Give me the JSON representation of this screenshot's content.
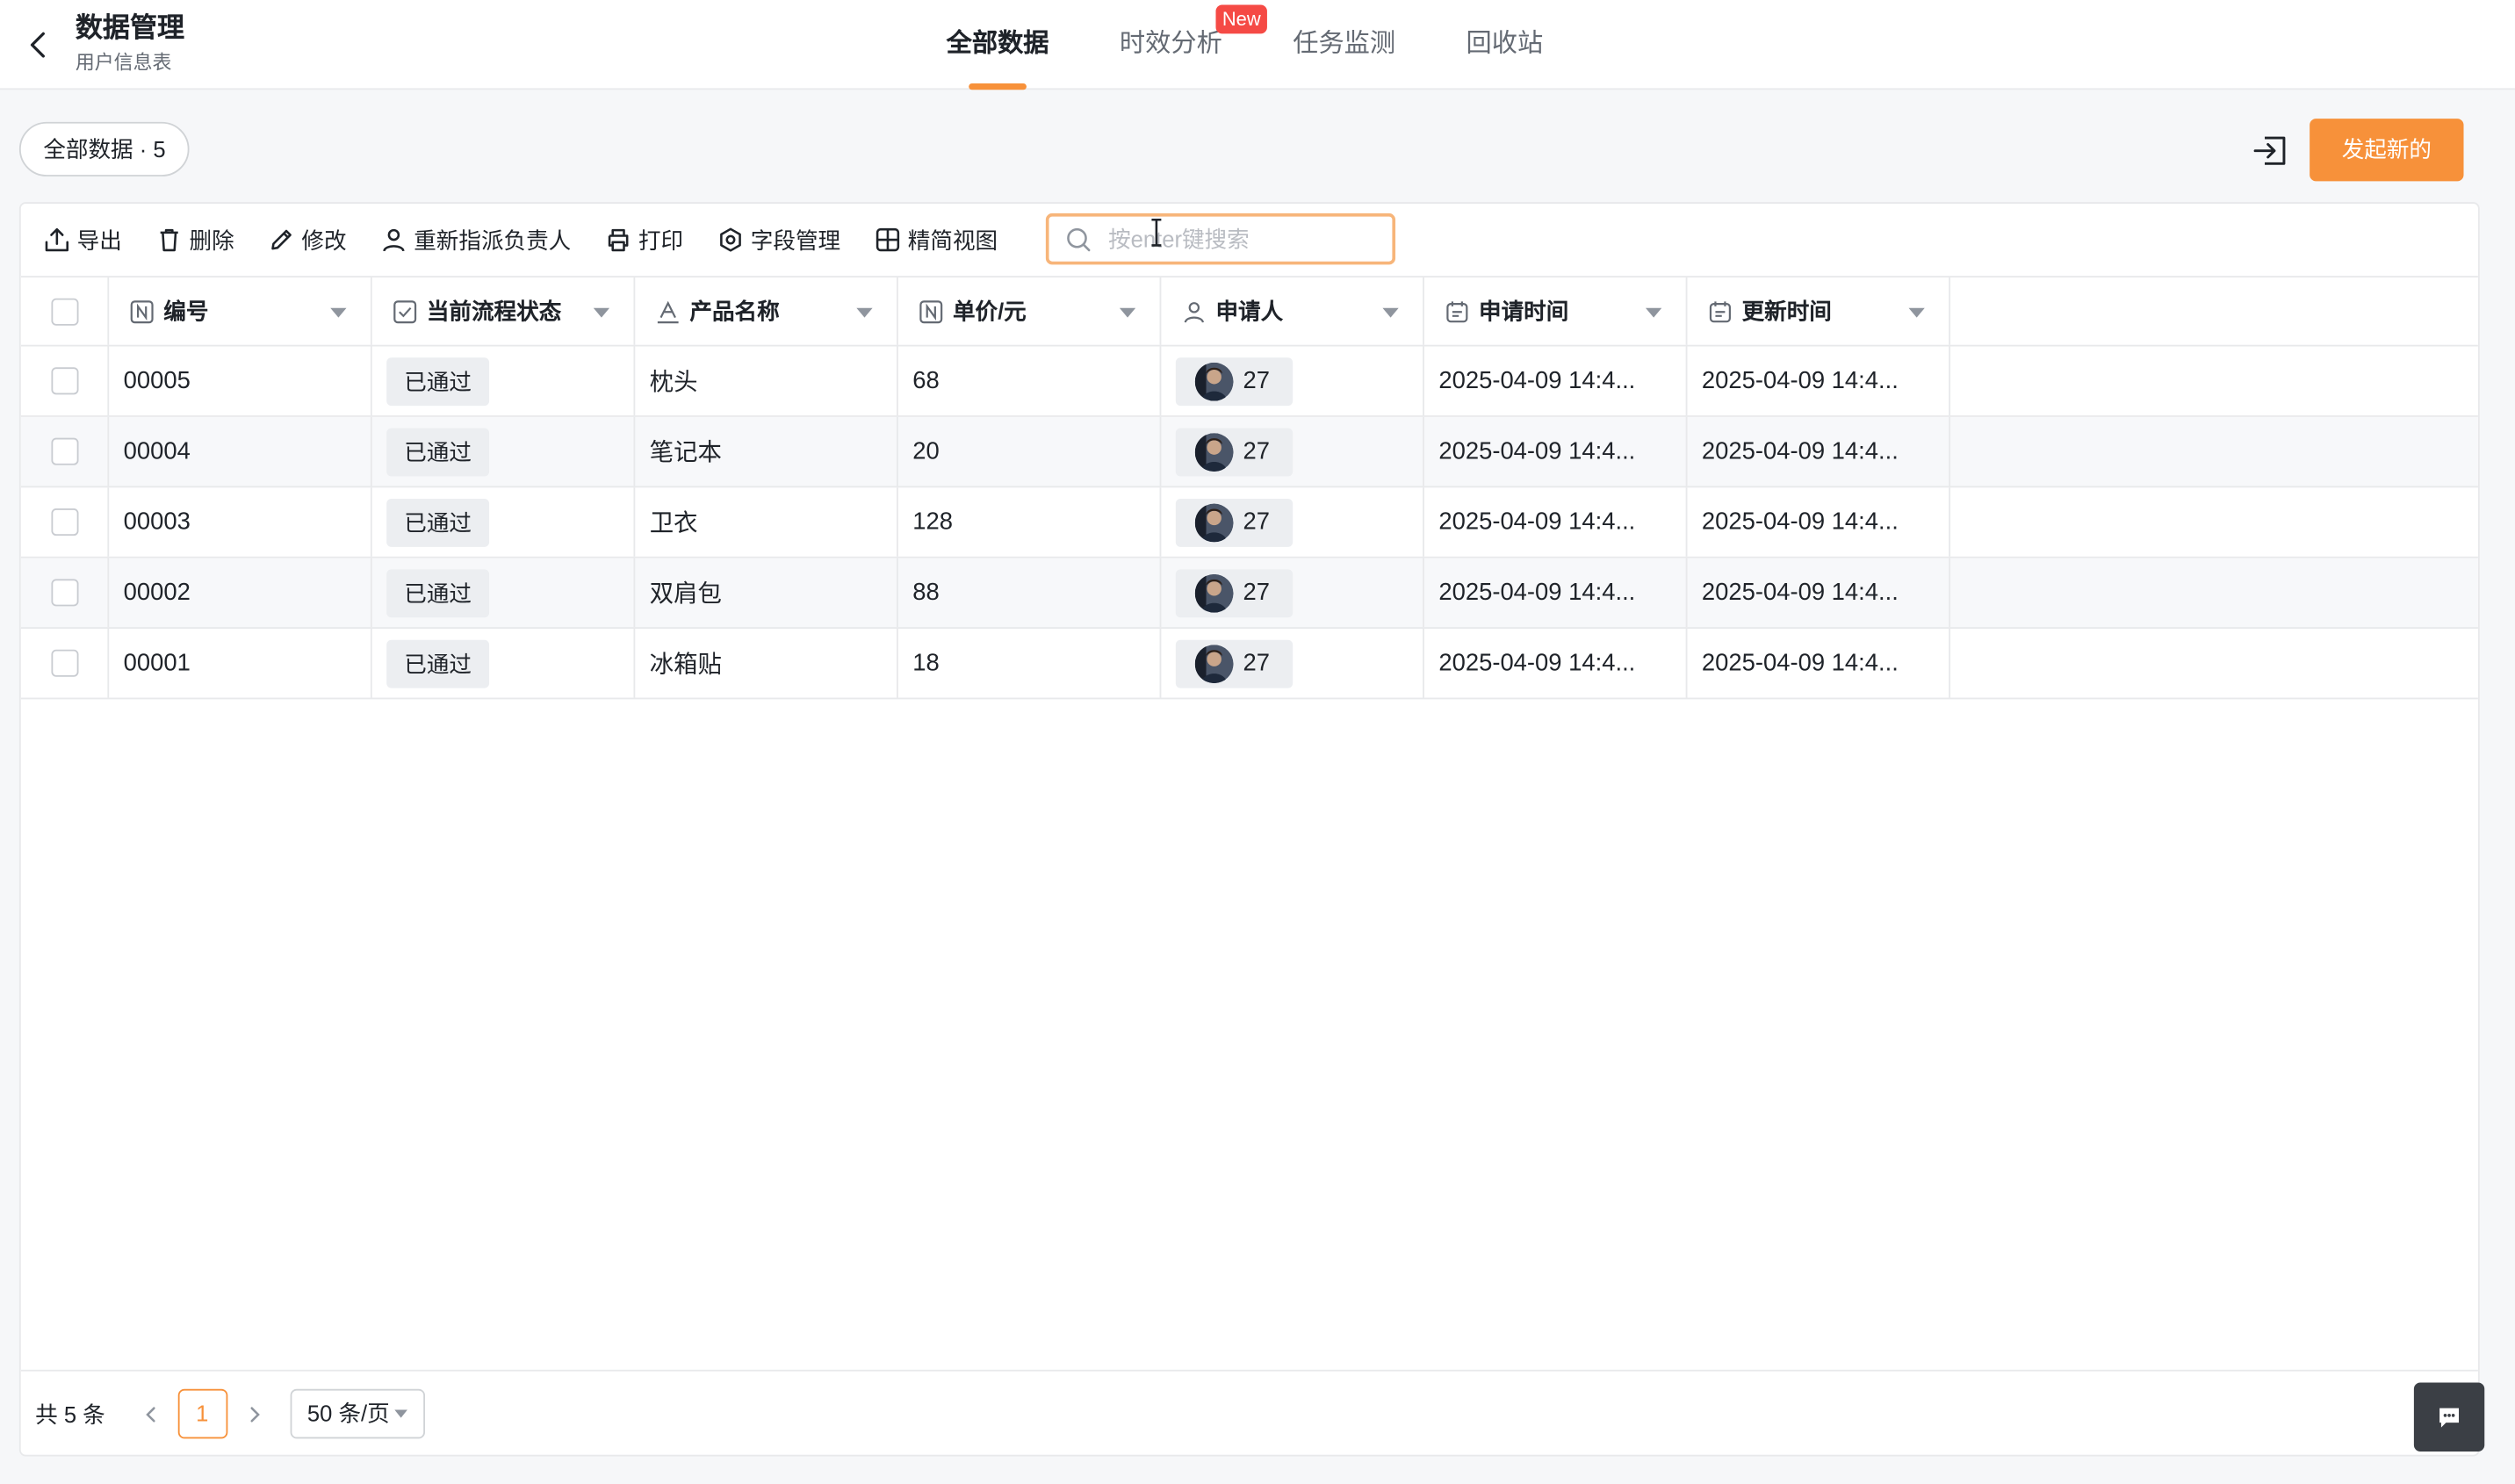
{
  "header": {
    "title": "数据管理",
    "subtitle": "用户信息表",
    "tabs": [
      {
        "label": "全部数据",
        "active": true
      },
      {
        "label": "时效分析",
        "badge": "New"
      },
      {
        "label": "任务监测"
      },
      {
        "label": "回收站"
      }
    ]
  },
  "toolbar": {
    "count_label": "全部数据 · 5",
    "new_button": "发起新的"
  },
  "actions": {
    "export": "导出",
    "delete": "删除",
    "edit": "修改",
    "reassign": "重新指派负责人",
    "print": "打印",
    "fields": "字段管理",
    "compact_view": "精简视图"
  },
  "search": {
    "placeholder": "按enter键搜索",
    "value": ""
  },
  "table": {
    "columns": [
      {
        "label": "编号",
        "icon": "number-icon"
      },
      {
        "label": "当前流程状态",
        "icon": "checkbox-icon"
      },
      {
        "label": "产品名称",
        "icon": "text-icon"
      },
      {
        "label": "单价/元",
        "icon": "number-icon"
      },
      {
        "label": "申请人",
        "icon": "person-icon"
      },
      {
        "label": "申请时间",
        "icon": "calendar-icon"
      },
      {
        "label": "更新时间",
        "icon": "calendar-icon"
      }
    ],
    "rows": [
      {
        "id": "00005",
        "status": "已通过",
        "product": "枕头",
        "price": "68",
        "applicant": "27",
        "applied": "2025-04-09 14:4...",
        "updated": "2025-04-09 14:4..."
      },
      {
        "id": "00004",
        "status": "已通过",
        "product": "笔记本",
        "price": "20",
        "applicant": "27",
        "applied": "2025-04-09 14:4...",
        "updated": "2025-04-09 14:4..."
      },
      {
        "id": "00003",
        "status": "已通过",
        "product": "卫衣",
        "price": "128",
        "applicant": "27",
        "applied": "2025-04-09 14:4...",
        "updated": "2025-04-09 14:4..."
      },
      {
        "id": "00002",
        "status": "已通过",
        "product": "双肩包",
        "price": "88",
        "applicant": "27",
        "applied": "2025-04-09 14:4...",
        "updated": "2025-04-09 14:4..."
      },
      {
        "id": "00001",
        "status": "已通过",
        "product": "冰箱贴",
        "price": "18",
        "applicant": "27",
        "applied": "2025-04-09 14:4...",
        "updated": "2025-04-09 14:4..."
      }
    ]
  },
  "pagination": {
    "total": "共 5 条",
    "current_page": "1",
    "page_size": "50 条/页"
  },
  "colors": {
    "accent": "#f7913a",
    "badge": "#f54a45",
    "tag_bg": "#eceef1"
  }
}
